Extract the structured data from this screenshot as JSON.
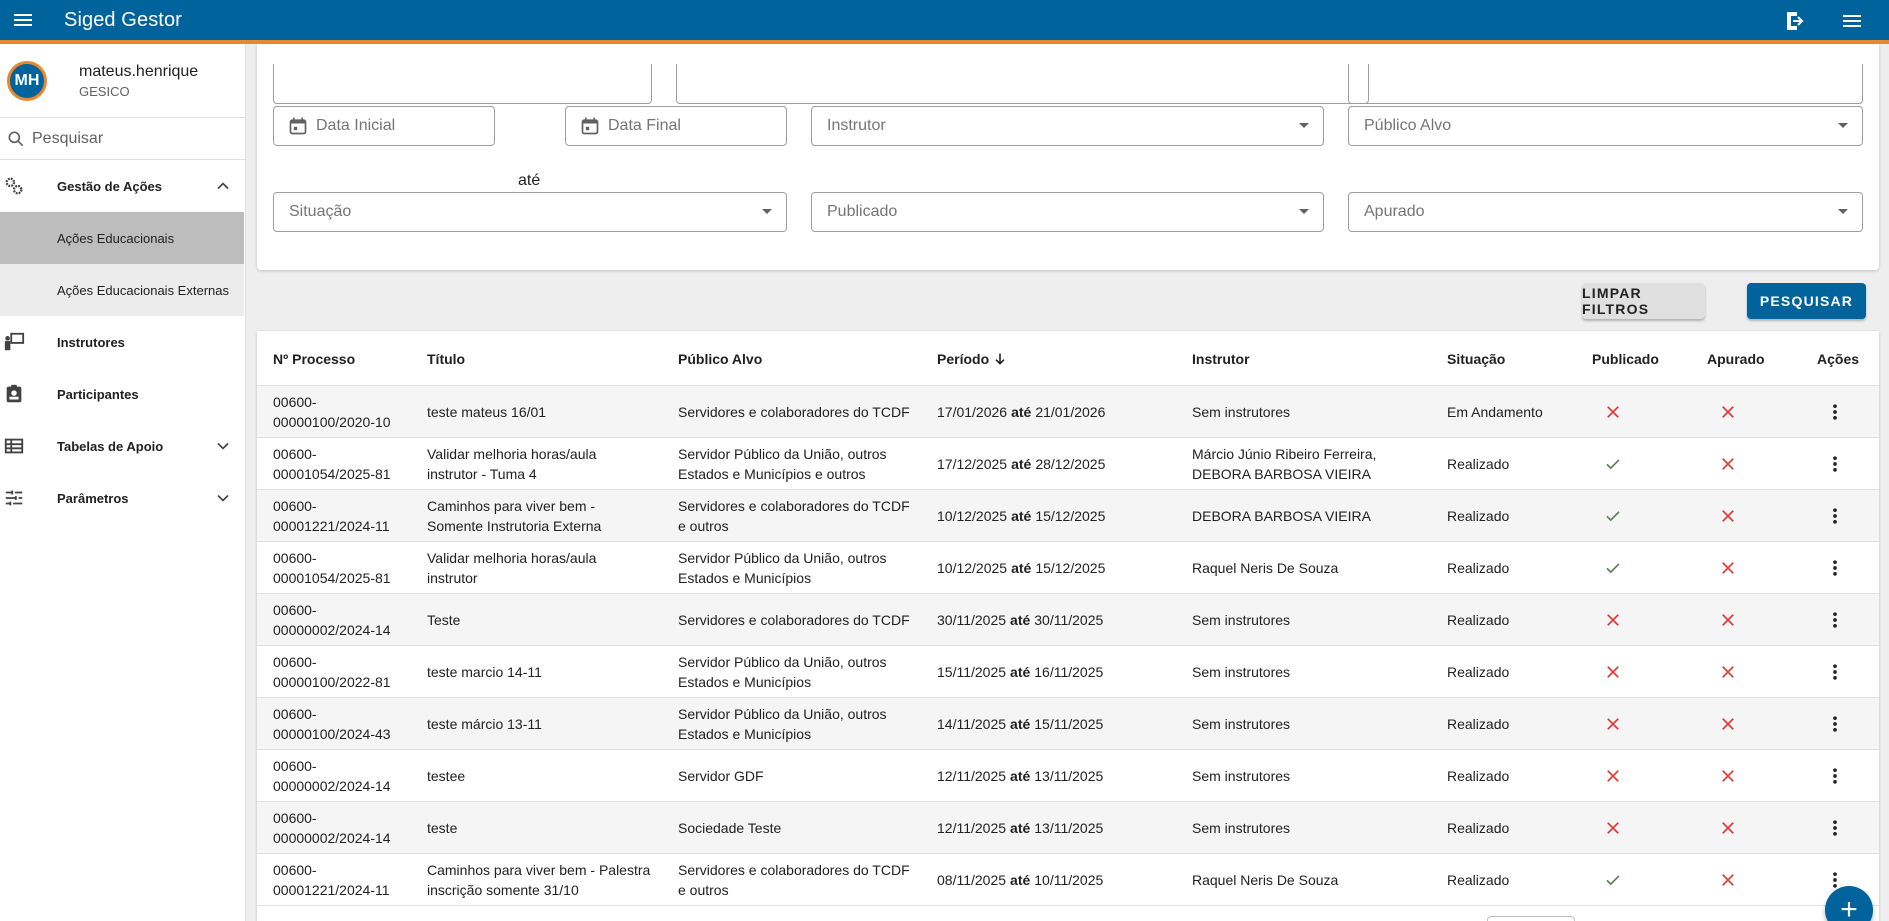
{
  "app": {
    "title": "Siged Gestor"
  },
  "user": {
    "initials": "MH",
    "name": "mateus.henrique",
    "org": "GESICO"
  },
  "sidebar": {
    "search_placeholder": "Pesquisar",
    "items": [
      {
        "label": "Gestão de Ações",
        "icon": "gears-icon"
      },
      {
        "label": "Ações Educacionais"
      },
      {
        "label": "Ações Educacionais Externas"
      },
      {
        "label": "Instrutores",
        "icon": "instructor-icon"
      },
      {
        "label": "Participantes",
        "icon": "badge-icon"
      },
      {
        "label": "Tabelas de Apoio",
        "icon": "table-icon"
      },
      {
        "label": "Parâmetros",
        "icon": "sliders-icon"
      }
    ]
  },
  "filters": {
    "data_inicial": "Data Inicial",
    "ate": "até",
    "data_final": "Data Final",
    "instrutor": "Instrutor",
    "publico_alvo": "Público Alvo",
    "situacao": "Situação",
    "publicado": "Publicado",
    "apurado": "Apurado",
    "clear_label": "LIMPAR FILTROS",
    "search_label": "PESQUISAR"
  },
  "table": {
    "headers": [
      "Nº Processo",
      "Título",
      "Público Alvo",
      "Período",
      "Instrutor",
      "Situação",
      "Publicado",
      "Apurado",
      "Ações"
    ],
    "until": "até",
    "rows": [
      {
        "proc": [
          "00600-",
          "00000100/2020-10"
        ],
        "titulo": [
          "teste mateus 16/01"
        ],
        "publico": [
          "Servidores e colaboradores do TCDF"
        ],
        "inicio": "17/01/2026",
        "fim": "21/01/2026",
        "instrutor": [
          "Sem instrutores"
        ],
        "situacao": "Em Andamento",
        "publicado": false,
        "apurado": false
      },
      {
        "proc": [
          "00600-",
          "00001054/2025-81"
        ],
        "titulo": [
          "Validar melhoria horas/aula",
          "instrutor - Tuma 4"
        ],
        "publico": [
          "Servidor Público da União, outros",
          "Estados e Municípios e outros"
        ],
        "inicio": "17/12/2025",
        "fim": "28/12/2025",
        "instrutor": [
          "Márcio Júnio Ribeiro Ferreira,",
          "DEBORA BARBOSA VIEIRA"
        ],
        "situacao": "Realizado",
        "publicado": true,
        "apurado": false
      },
      {
        "proc": [
          "00600-",
          "00001221/2024-11"
        ],
        "titulo": [
          "Caminhos para viver bem -",
          "Somente Instrutoria Externa"
        ],
        "publico": [
          "Servidores e colaboradores do TCDF",
          "e outros"
        ],
        "inicio": "10/12/2025",
        "fim": "15/12/2025",
        "instrutor": [
          "DEBORA BARBOSA VIEIRA"
        ],
        "situacao": "Realizado",
        "publicado": true,
        "apurado": false
      },
      {
        "proc": [
          "00600-",
          "00001054/2025-81"
        ],
        "titulo": [
          "Validar melhoria horas/aula",
          "instrutor"
        ],
        "publico": [
          "Servidor Público da União, outros",
          "Estados e Municípios"
        ],
        "inicio": "10/12/2025",
        "fim": "15/12/2025",
        "instrutor": [
          "Raquel Neris De Souza"
        ],
        "situacao": "Realizado",
        "publicado": true,
        "apurado": false
      },
      {
        "proc": [
          "00600-",
          "00000002/2024-14"
        ],
        "titulo": [
          "Teste"
        ],
        "publico": [
          "Servidores e colaboradores do TCDF"
        ],
        "inicio": "30/11/2025",
        "fim": "30/11/2025",
        "instrutor": [
          "Sem instrutores"
        ],
        "situacao": "Realizado",
        "publicado": false,
        "apurado": false
      },
      {
        "proc": [
          "00600-",
          "00000100/2022-81"
        ],
        "titulo": [
          "teste marcio 14-11"
        ],
        "publico": [
          "Servidor Público da União, outros",
          "Estados e Municípios"
        ],
        "inicio": "15/11/2025",
        "fim": "16/11/2025",
        "instrutor": [
          "Sem instrutores"
        ],
        "situacao": "Realizado",
        "publicado": false,
        "apurado": false
      },
      {
        "proc": [
          "00600-",
          "00000100/2024-43"
        ],
        "titulo": [
          "teste márcio 13-11"
        ],
        "publico": [
          "Servidor Público da União, outros",
          "Estados e Municípios"
        ],
        "inicio": "14/11/2025",
        "fim": "15/11/2025",
        "instrutor": [
          "Sem instrutores"
        ],
        "situacao": "Realizado",
        "publicado": false,
        "apurado": false
      },
      {
        "proc": [
          "00600-",
          "00000002/2024-14"
        ],
        "titulo": [
          "testee"
        ],
        "publico": [
          "Servidor GDF"
        ],
        "inicio": "12/11/2025",
        "fim": "13/11/2025",
        "instrutor": [
          "Sem instrutores"
        ],
        "situacao": "Realizado",
        "publicado": false,
        "apurado": false
      },
      {
        "proc": [
          "00600-",
          "00000002/2024-14"
        ],
        "titulo": [
          "teste"
        ],
        "publico": [
          "Sociedade Teste"
        ],
        "inicio": "12/11/2025",
        "fim": "13/11/2025",
        "instrutor": [
          "Sem instrutores"
        ],
        "situacao": "Realizado",
        "publicado": false,
        "apurado": false
      },
      {
        "proc": [
          "00600-",
          "00001221/2024-11"
        ],
        "titulo": [
          "Caminhos para viver bem - Palestra",
          "inscrição somente 31/10"
        ],
        "publico": [
          "Servidores e colaboradores do TCDF",
          "e outros"
        ],
        "inicio": "08/11/2025",
        "fim": "10/11/2025",
        "instrutor": [
          "Raquel Neris De Souza"
        ],
        "situacao": "Realizado",
        "publicado": true,
        "apurado": false
      }
    ]
  },
  "colors": {
    "primary": "#01639b",
    "accent": "#e8872c",
    "check": "#5f7f57",
    "cross": "#e53935"
  },
  "fab": {
    "label": "+"
  }
}
